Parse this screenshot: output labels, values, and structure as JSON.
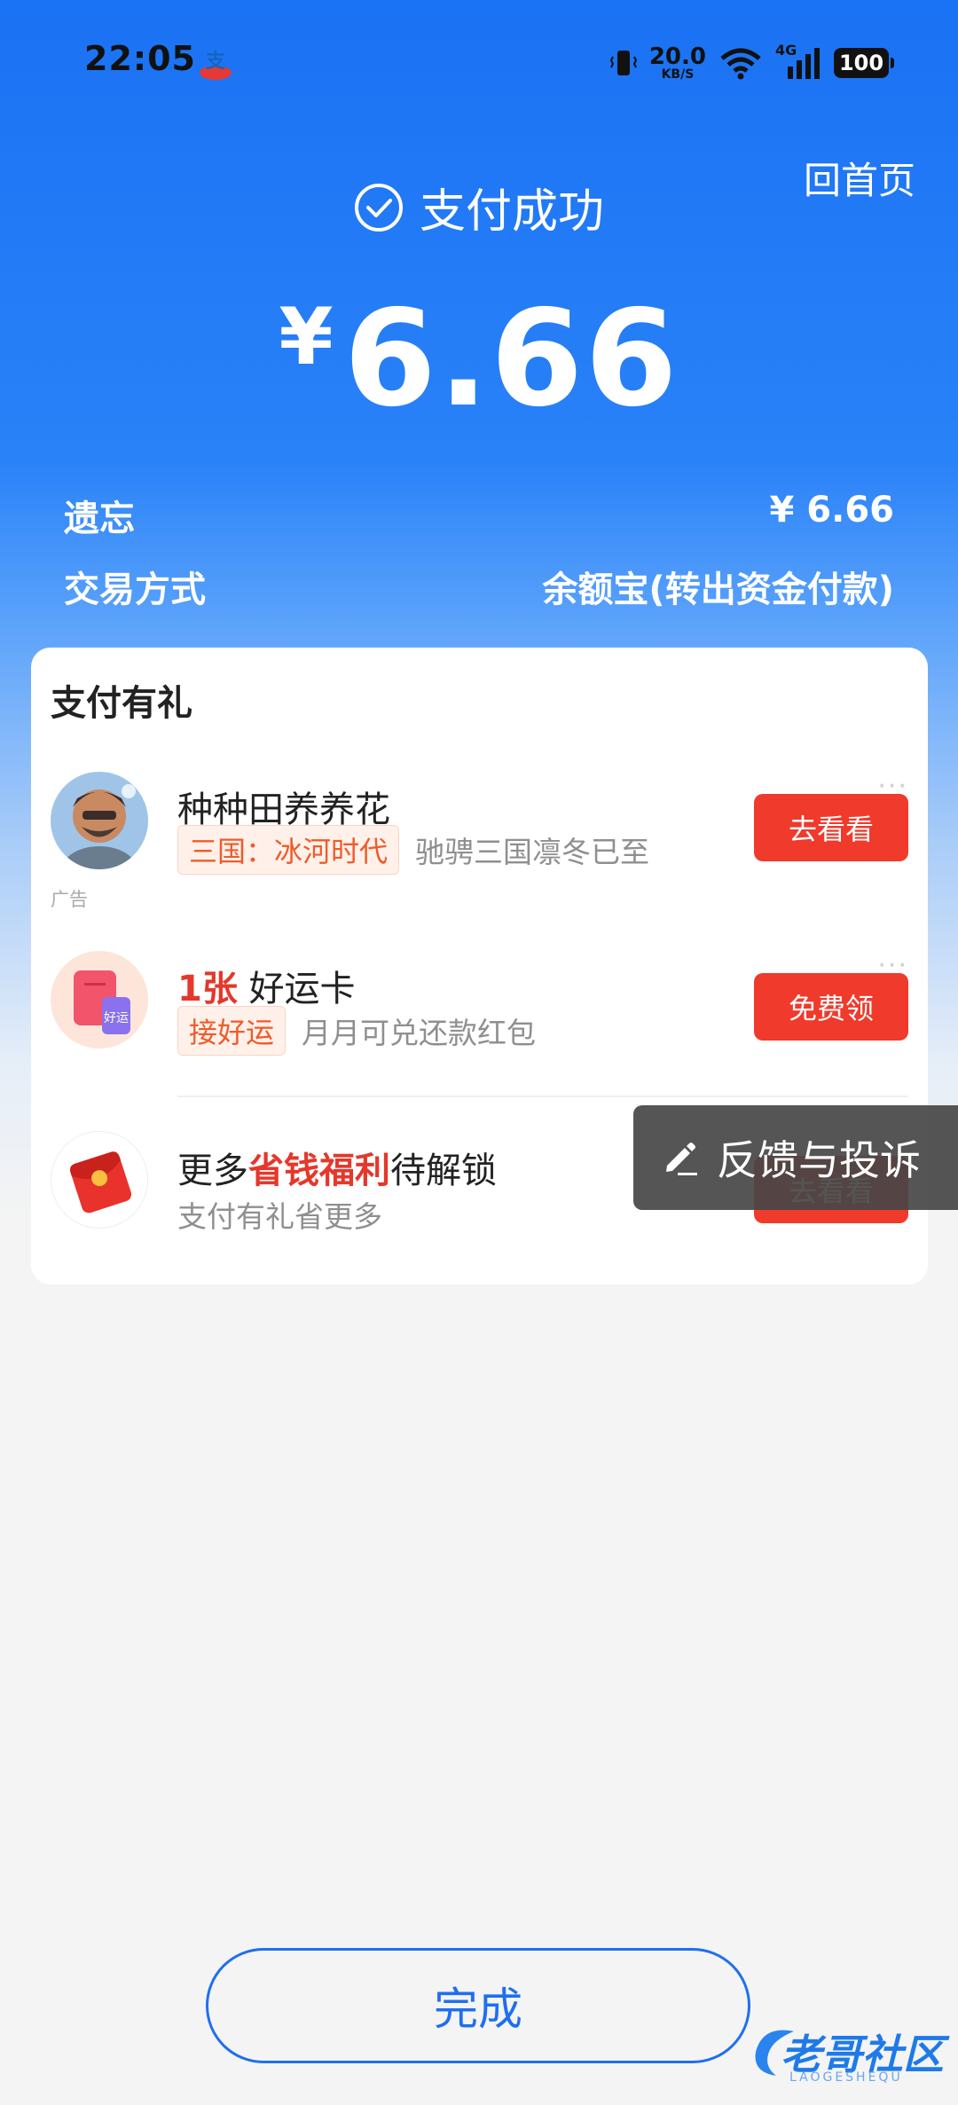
{
  "status_bar": {
    "time": "22:05",
    "net_speed_value": "20.0",
    "net_speed_unit": "KB/S",
    "network_type": "4G",
    "battery": "100"
  },
  "header": {
    "home_link": "回首页",
    "status_text": "支付成功",
    "currency_symbol": "¥",
    "amount": "6.66"
  },
  "details": [
    {
      "label": "遗忘",
      "value": "¥ 6.66"
    },
    {
      "label": "交易方式",
      "value": "余额宝(转出资金付款)"
    }
  ],
  "rewards_card": {
    "title": "支付有礼",
    "ad_label": "广告",
    "items": [
      {
        "title": "种种田养养花",
        "tag": "三国：冰河时代",
        "desc": "驰骋三国凛冬已至",
        "button": "去看看",
        "icon": "game-avatar-icon"
      },
      {
        "title_highlight": "1张",
        "title_rest": "好运卡",
        "tag": "接好运",
        "desc": "月月可兑还款红包",
        "button": "免费领",
        "icon": "red-packet-card-icon"
      },
      {
        "title_prefix": "更多",
        "title_highlight": "省钱福利",
        "title_suffix": "待解锁",
        "desc": "支付有礼省更多",
        "button": "去看看",
        "icon": "red-envelope-icon"
      }
    ]
  },
  "feedback_button": "反馈与投诉",
  "done_button": "完成",
  "watermark": {
    "text": "老哥社区",
    "subtext": "LAOGESHEQU"
  },
  "colors": {
    "primary_blue": "#1a72f4",
    "action_red": "#ef3a2c",
    "tag_orange": "#ef5b2a"
  }
}
